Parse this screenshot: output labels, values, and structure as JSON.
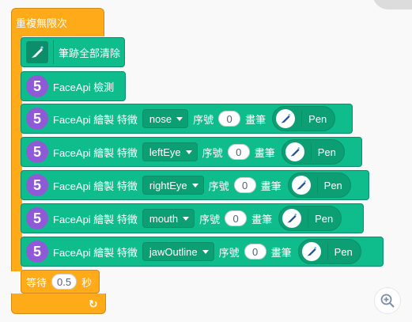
{
  "forever": {
    "label": "重複無限次"
  },
  "blocks": {
    "clear": {
      "label": "筆跡全部清除"
    },
    "detect": {
      "label": "FaceApi 檢測"
    },
    "draw": [
      {
        "prefix": "FaceApi 繪製 特徵",
        "feature": "nose",
        "index_label": "序號",
        "index": "0",
        "pen_label": "畫筆",
        "pen": "Pen"
      },
      {
        "prefix": "FaceApi 繪製 特徵",
        "feature": "leftEye",
        "index_label": "序號",
        "index": "0",
        "pen_label": "畫筆",
        "pen": "Pen"
      },
      {
        "prefix": "FaceApi 繪製 特徵",
        "feature": "rightEye",
        "index_label": "序號",
        "index": "0",
        "pen_label": "畫筆",
        "pen": "Pen"
      },
      {
        "prefix": "FaceApi 繪製 特徵",
        "feature": "mouth",
        "index_label": "序號",
        "index": "0",
        "pen_label": "畫筆",
        "pen": "Pen"
      },
      {
        "prefix": "FaceApi 繪製 特徵",
        "feature": "jawOutline",
        "index_label": "序號",
        "index": "0",
        "pen_label": "畫筆",
        "pen": "Pen"
      }
    ]
  },
  "wait": {
    "label": "等待",
    "value": "0.5",
    "unit": "秒"
  },
  "icons": {
    "extension_badge": "5",
    "pen": "pen-icon",
    "zoom": "zoom-in-icon",
    "loop": "loop-arrow-icon"
  },
  "colors": {
    "control": "#ffab19",
    "pen": "#0fbd8c",
    "extension": "#8f5ad6"
  }
}
